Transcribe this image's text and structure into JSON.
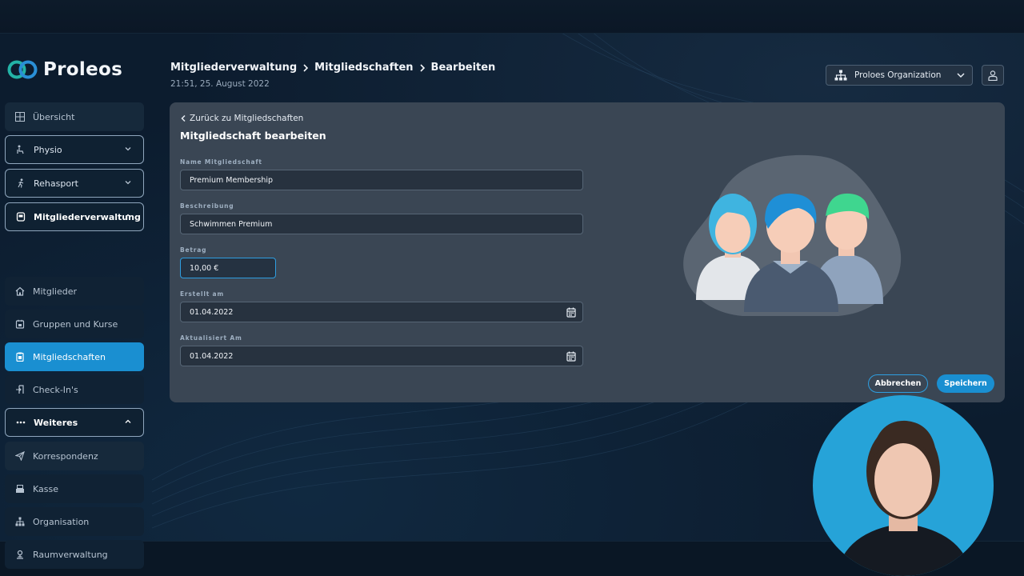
{
  "app": {
    "name": "Proleos"
  },
  "sidebar": {
    "items": [
      {
        "label": "Übersicht",
        "icon": "grid-icon"
      },
      {
        "label": "Physio",
        "icon": "physio-icon"
      },
      {
        "label": "Rehasport",
        "icon": "running-icon"
      },
      {
        "label": "Mitgliederverwaltung",
        "icon": "member-card-icon"
      },
      {
        "label": "Mitglieder",
        "icon": "house-icon"
      },
      {
        "label": "Gruppen und Kurse",
        "icon": "calendar-icon"
      },
      {
        "label": "Mitgliedschaften",
        "icon": "clipboard-icon"
      },
      {
        "label": "Check-In's",
        "icon": "door-icon"
      },
      {
        "label": "Weiteres",
        "icon": "dots-icon"
      },
      {
        "label": "Korrespondenz",
        "icon": "send-icon"
      },
      {
        "label": "Kasse",
        "icon": "register-icon"
      },
      {
        "label": "Organisation",
        "icon": "hierarchy-icon"
      },
      {
        "label": "Raumverwaltung",
        "icon": "location-icon"
      }
    ]
  },
  "header": {
    "breadcrumb": [
      "Mitgliederverwaltung",
      "Mitgliedschaften",
      "Bearbeiten"
    ],
    "datetime": "21:51, 25. August 2022",
    "org_select": "Proloes Organization"
  },
  "form": {
    "back_link": "Zurück zu Mitgliedschaften",
    "title": "Mitgliedschaft bearbeiten",
    "fields": {
      "name": {
        "label": "Name Mitgliedschaft",
        "value": "Premium Membership"
      },
      "description": {
        "label": "Beschreibung",
        "value": "Schwimmen Premium"
      },
      "amount": {
        "label": "Betrag",
        "value": "10,00 €"
      },
      "created": {
        "label": "Erstellt am",
        "value": "01.04.2022"
      },
      "updated": {
        "label": "Aktualisiert Am",
        "value": "01.04.2022"
      }
    },
    "cancel_label": "Abbrechen",
    "save_label": "Speichern"
  },
  "colors": {
    "accent": "#1a8fd1",
    "card": "#3a4654",
    "background": "#0c1c2e"
  }
}
